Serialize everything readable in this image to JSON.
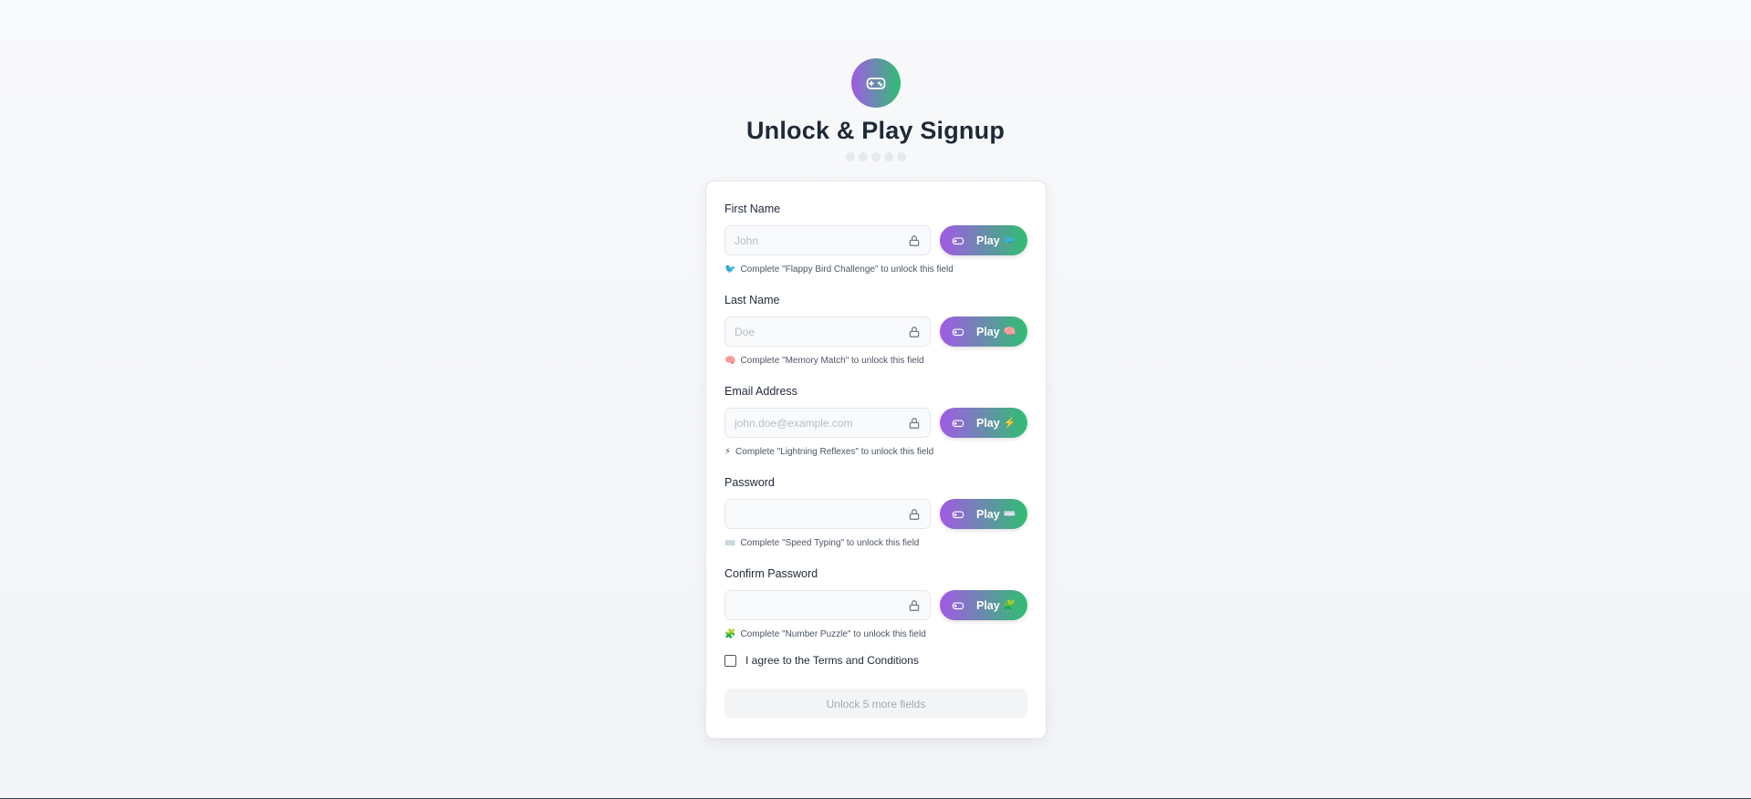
{
  "header": {
    "logo_icon": "gamepad-icon",
    "title": "Unlock & Play Signup",
    "progress_dots": 5,
    "progress_completed": 0
  },
  "fields": [
    {
      "label": "First Name",
      "placeholder": "John",
      "input_type": "text",
      "play_label": "Play",
      "play_emoji": "🐦",
      "hint_emoji": "🐦",
      "hint": "Complete \"Flappy Bird Challenge\" to unlock this field"
    },
    {
      "label": "Last Name",
      "placeholder": "Doe",
      "input_type": "text",
      "play_label": "Play",
      "play_emoji": "🧠",
      "hint_emoji": "🧠",
      "hint": "Complete \"Memory Match\" to unlock this field"
    },
    {
      "label": "Email Address",
      "placeholder": "john.doe@example.com",
      "input_type": "text",
      "play_label": "Play",
      "play_emoji": "⚡",
      "hint_emoji": "⚡",
      "hint": "Complete \"Lightning Reflexes\" to unlock this field"
    },
    {
      "label": "Password",
      "placeholder": "",
      "input_type": "password",
      "play_label": "Play",
      "play_emoji": "⌨️",
      "hint_emoji": "⌨️",
      "hint": "Complete \"Speed Typing\" to unlock this field"
    },
    {
      "label": "Confirm Password",
      "placeholder": "",
      "input_type": "password",
      "play_label": "Play",
      "play_emoji": "🧩",
      "hint_emoji": "🧩",
      "hint": "Complete \"Number Puzzle\" to unlock this field"
    }
  ],
  "terms": {
    "label": "I agree to the Terms and Conditions",
    "checked": false
  },
  "submit": {
    "label": "Unlock 5 more fields",
    "disabled": true
  },
  "colors": {
    "gradient_start": "#a259e6",
    "gradient_end": "#2fbf71"
  }
}
